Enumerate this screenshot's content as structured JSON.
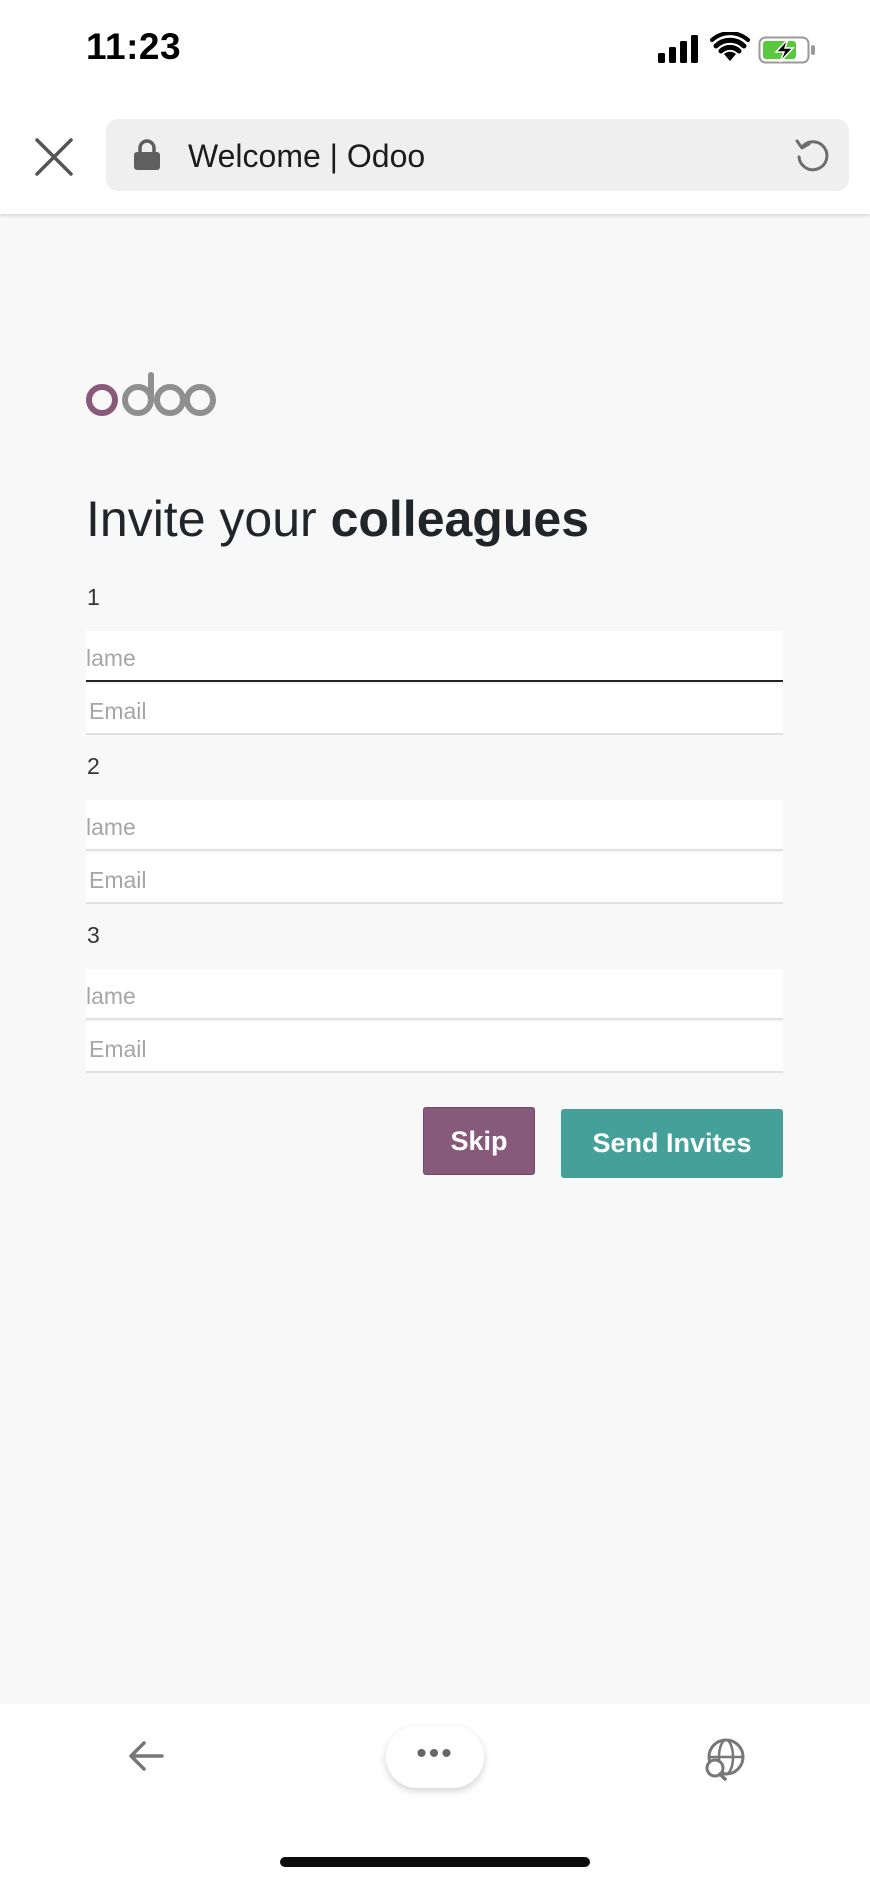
{
  "status_bar": {
    "time": "11:23"
  },
  "browser": {
    "page_title": "Welcome | Odoo"
  },
  "logo": {
    "text": "odoo",
    "colors": {
      "o_primary": "#875a7b",
      "o_secondary": "#8f8f8f"
    }
  },
  "form": {
    "heading_prefix": "Invite your ",
    "heading_bold": "colleagues",
    "groups": [
      {
        "number": "1",
        "name_placeholder": "lame",
        "email_placeholder": "Email"
      },
      {
        "number": "2",
        "name_placeholder": "lame",
        "email_placeholder": "Email"
      },
      {
        "number": "3",
        "name_placeholder": "lame",
        "email_placeholder": "Email"
      }
    ],
    "skip_label": "Skip",
    "send_label": "Send Invites"
  },
  "toolbar": {
    "more_label": "•••"
  },
  "colors": {
    "skip": "#875a7b",
    "send": "#46a09a",
    "background": "#f8f8f8"
  },
  "icons": [
    "signal-icon",
    "wifi-icon",
    "battery-charging-icon",
    "close-icon",
    "lock-icon",
    "reload-icon",
    "back-arrow-icon",
    "more-icon",
    "globe-search-icon"
  ]
}
